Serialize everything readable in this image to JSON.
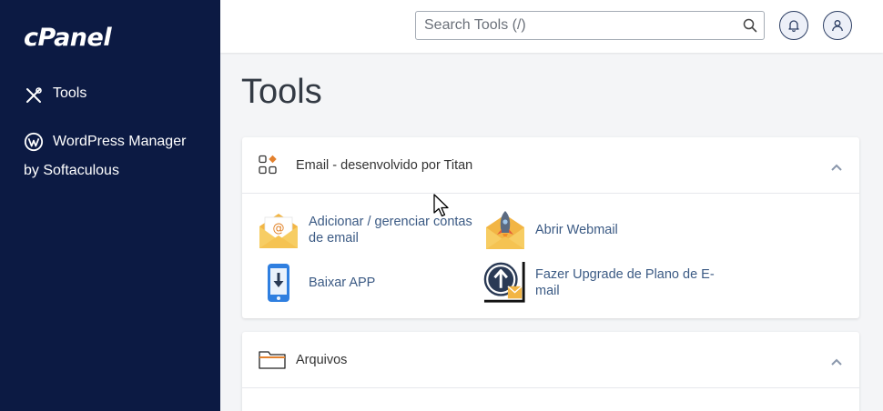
{
  "sidebar": {
    "logo": "cPanel",
    "items": [
      {
        "label": "Tools",
        "icon": "tools-icon"
      },
      {
        "label_line1": "WordPress Manager",
        "label_line2": "by Softaculous",
        "icon": "wordpress-icon"
      }
    ]
  },
  "topbar": {
    "search_placeholder": "Search Tools (/)",
    "icons": [
      "search-icon",
      "bell-icon",
      "user-icon"
    ]
  },
  "page": {
    "title": "Tools"
  },
  "sections": [
    {
      "title": "Email - desenvolvido por Titan",
      "icon": "apps-grid-icon",
      "tools": [
        {
          "label": "Adicionar / gerenciar contas de email",
          "icon": "email-envelope-icon"
        },
        {
          "label": "Abrir Webmail",
          "icon": "webmail-rocket-icon"
        },
        {
          "label": "Baixar APP",
          "icon": "mobile-download-icon"
        },
        {
          "label": "Fazer Upgrade de Plano de E-mail",
          "icon": "upgrade-mail-icon"
        }
      ]
    },
    {
      "title": "Arquivos",
      "icon": "folder-icon",
      "tools": []
    }
  ],
  "colors": {
    "sidebar_bg": "#0c1a43",
    "link": "#3b5a84",
    "envelope": "#f4c45a"
  }
}
